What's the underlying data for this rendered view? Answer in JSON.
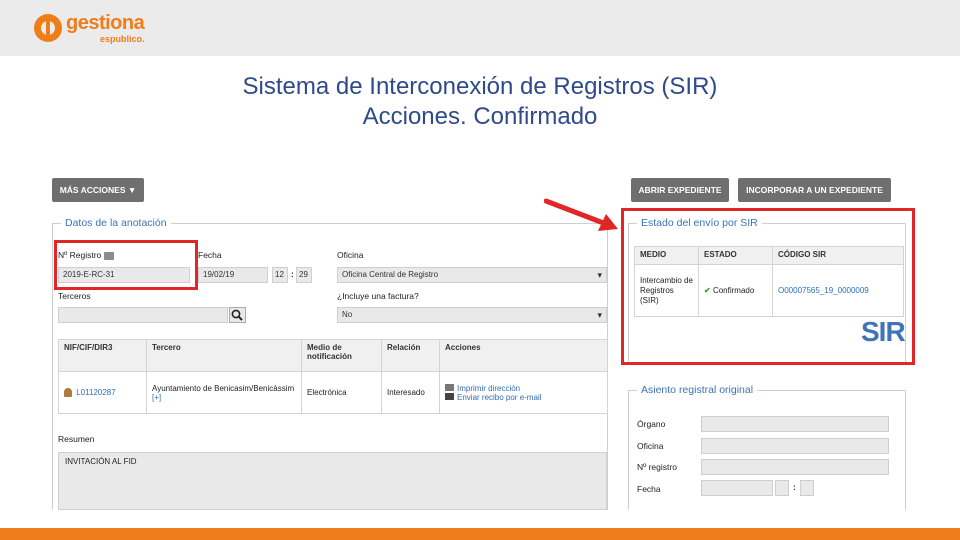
{
  "logo": {
    "name": "gestiona",
    "sub": "espublico."
  },
  "slide": {
    "title_line1": "Sistema de Interconexión de Registros (SIR)",
    "title_line2": "Acciones. Confirmado"
  },
  "toolbar": {
    "more_actions": "MÁS ACCIONES ▼",
    "open_expedient": "ABRIR EXPEDIENTE",
    "incorporate": "INCORPORAR A UN EXPEDIENTE"
  },
  "annotation": {
    "legend": "Datos de la anotación",
    "registro_label": "Nº Registro",
    "registro_value": "2019-E-RC-31",
    "fecha_label": "Fecha",
    "fecha_value": "19/02/19",
    "hora": "12",
    "minutos": "29",
    "oficina_label": "Oficina",
    "oficina_value": "Oficina Central de Registro",
    "terceros_label": "Terceros",
    "factura_label": "¿Incluye una factura?",
    "factura_value": "No",
    "table": {
      "headers": [
        "NIF/CIF/DIR3",
        "Tercero",
        "Medio de notificación",
        "Relación",
        "Acciones"
      ],
      "row": {
        "nif": "L01120287",
        "tercero": "Ayuntamiento de Benicasim/Benicàssim",
        "more": "[+]",
        "medio": "Electrónica",
        "relacion": "Interesado",
        "action1": "Imprimir dirección",
        "action2": "Enviar recibo por e-mail"
      }
    },
    "resumen_label": "Resumen",
    "resumen_value": "INVITACIÓN AL FID"
  },
  "sir_status": {
    "legend": "Estado del envío por SIR",
    "headers": [
      "MEDIO",
      "ESTADO",
      "CÓDIGO SIR"
    ],
    "medio": "Intercambio de Registros (SIR)",
    "estado": "Confirmado",
    "codigo": "O00007565_19_0000009",
    "logo_text": "SIR"
  },
  "original": {
    "legend": "Asiento registral original",
    "organo_label": "Órgano",
    "oficina_label": "Oficina",
    "registro_label": "Nº registro",
    "fecha_label": "Fecha"
  },
  "colors": {
    "accent": "#ef7d1a",
    "title": "#2e4a8a",
    "highlight": "#e02626",
    "link": "#2f6db5"
  }
}
